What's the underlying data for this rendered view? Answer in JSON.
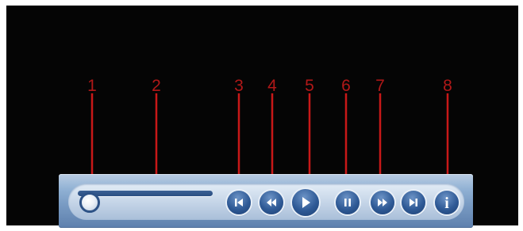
{
  "callouts": {
    "labels": [
      "1",
      "2",
      "3",
      "4",
      "5",
      "6",
      "7",
      "8"
    ],
    "color": "#c81818"
  },
  "player": {
    "seek_progress": 0.0,
    "controls": [
      {
        "name": "previous-track-icon"
      },
      {
        "name": "rewind-icon"
      },
      {
        "name": "play-icon"
      },
      {
        "name": "pause-icon"
      },
      {
        "name": "fast-forward-icon"
      },
      {
        "name": "next-track-icon"
      },
      {
        "name": "info-icon",
        "glyph": "i"
      }
    ],
    "colors": {
      "bar": "#7a9cc4",
      "button": "#2f5a96",
      "screen": "#050505"
    }
  }
}
